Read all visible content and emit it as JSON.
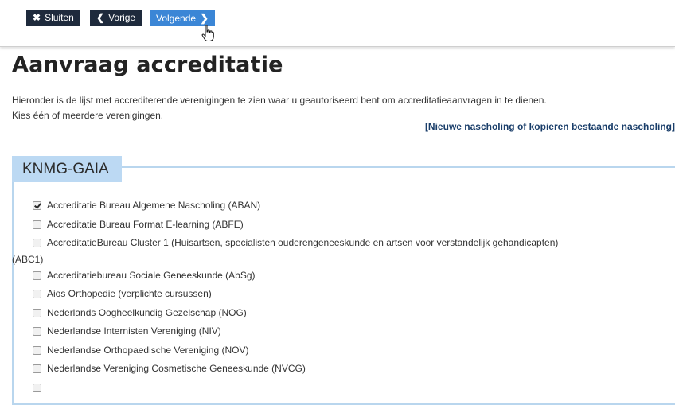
{
  "toolbar": {
    "close_label": "Sluiten",
    "prev_label": "Vorige",
    "next_label": "Volgende"
  },
  "page": {
    "title": "Aanvraag accreditatie",
    "intro_line1": "Hieronder is de lijst met accrediterende verenigingen te zien waar u geautoriseerd bent om accreditatieaanvragen in te dienen.",
    "intro_line2": "Kies één of meerdere verenigingen.",
    "new_link": "[Nieuwe nascholing of kopieren bestaande nascholing]"
  },
  "fieldset": {
    "legend": "KNMG-GAIA",
    "items": [
      {
        "label": "Accreditatie Bureau Algemene Nascholing (ABAN)",
        "checked": true
      },
      {
        "label": "Accreditatie Bureau Format E-learning (ABFE)",
        "checked": false
      },
      {
        "label": "AccreditatieBureau Cluster 1 (Huisartsen, specialisten ouderengeneeskunde en artsen voor verstandelijk gehandicapten)",
        "label_cont": "(ABC1)",
        "checked": false
      },
      {
        "label": "Accreditatiebureau Sociale Geneeskunde (AbSg)",
        "checked": false
      },
      {
        "label": "Aios Orthopedie (verplichte cursussen)",
        "checked": false
      },
      {
        "label": "Nederlands Oogheelkundig Gezelschap (NOG)",
        "checked": false
      },
      {
        "label": "Nederlandse Internisten Vereniging (NIV)",
        "checked": false
      },
      {
        "label": "Nederlandse Orthopaedische Vereniging (NOV)",
        "checked": false
      },
      {
        "label": "Nederlandse Vereniging Cosmetische Geneeskunde (NVCG)",
        "checked": false
      }
    ]
  },
  "colors": {
    "dark_button": "#1e2a3c",
    "active_button": "#3b86d6",
    "legend_bg": "#bcd9f3",
    "fieldset_border": "#b9d6ee",
    "link": "#1a3e6a"
  },
  "icons": [
    "close-icon",
    "chevron-left-icon",
    "chevron-right-icon",
    "hand-pointer-cursor-icon",
    "checkbox-icon"
  ]
}
